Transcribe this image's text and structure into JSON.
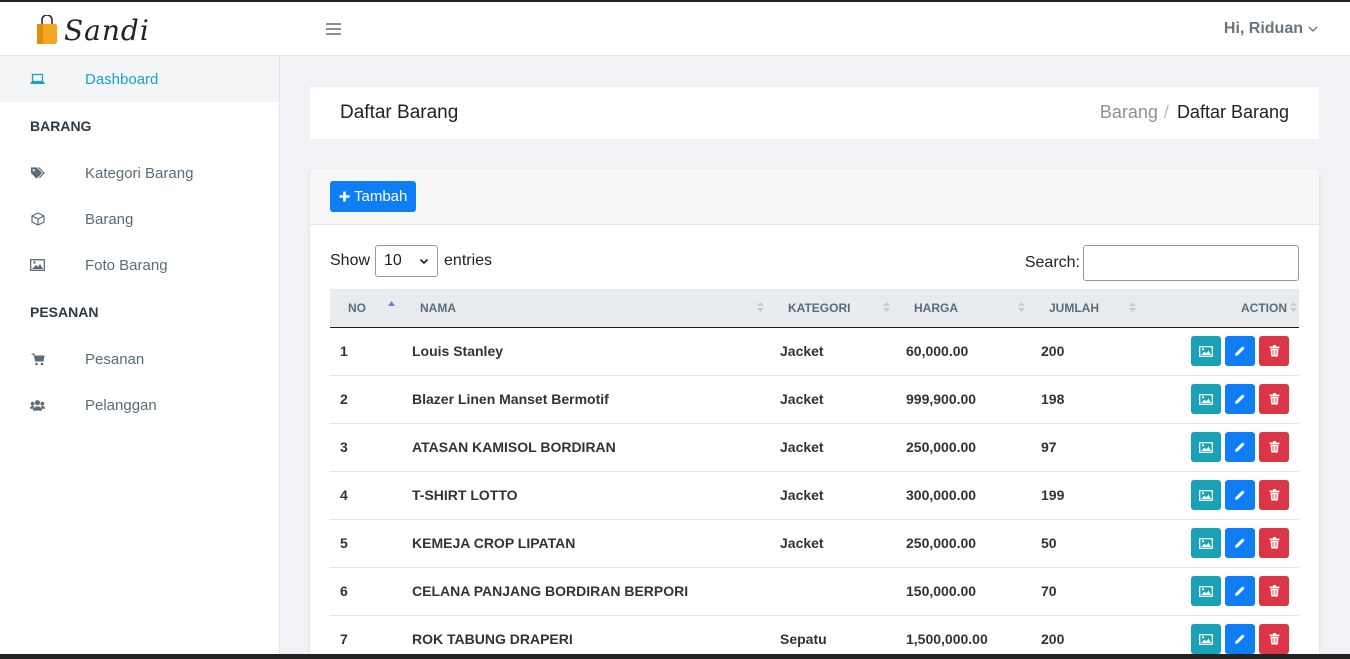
{
  "brand": {
    "name": "Sandi"
  },
  "topbar": {
    "greeting": "Hi, Riduan"
  },
  "sidebar": {
    "dashboard": "Dashboard",
    "section_barang": "BARANG",
    "kategori": "Kategori Barang",
    "barang": "Barang",
    "foto": "Foto Barang",
    "section_pesanan": "PESANAN",
    "pesanan": "Pesanan",
    "pelanggan": "Pelanggan"
  },
  "header": {
    "title": "Daftar Barang",
    "breadcrumb_parent": "Barang",
    "breadcrumb_sep": "/",
    "breadcrumb_current": "Daftar Barang"
  },
  "toolbar": {
    "add_label": "Tambah"
  },
  "table_controls": {
    "show_label": "Show",
    "page_length": "10",
    "entries_label": "entries",
    "search_label": "Search:"
  },
  "table": {
    "columns": [
      "NO",
      "NAMA",
      "KATEGORI",
      "HARGA",
      "JUMLAH",
      "ACTION"
    ],
    "rows": [
      {
        "no": "1",
        "nama": "Louis Stanley",
        "kategori": "Jacket",
        "harga": "60,000.00",
        "jumlah": "200"
      },
      {
        "no": "2",
        "nama": "Blazer Linen Manset Bermotif",
        "kategori": "Jacket",
        "harga": "999,900.00",
        "jumlah": "198"
      },
      {
        "no": "3",
        "nama": "ATASAN KAMISOL BORDIRAN",
        "kategori": "Jacket",
        "harga": "250,000.00",
        "jumlah": "97"
      },
      {
        "no": "4",
        "nama": "T-SHIRT LOTTO",
        "kategori": "Jacket",
        "harga": "300,000.00",
        "jumlah": "199"
      },
      {
        "no": "5",
        "nama": "KEMEJA CROP LIPATAN",
        "kategori": "Jacket",
        "harga": "250,000.00",
        "jumlah": "50"
      },
      {
        "no": "6",
        "nama": "CELANA PANJANG BORDIRAN BERPORI",
        "kategori": "",
        "harga": "150,000.00",
        "jumlah": "70"
      },
      {
        "no": "7",
        "nama": "ROK TABUNG DRAPERI",
        "kategori": "Sepatu",
        "harga": "1,500,000.00",
        "jumlah": "200"
      }
    ]
  },
  "colors": {
    "primary": "#0d7ef5",
    "info": "#17a2b8",
    "danger": "#dc3545",
    "active_link": "#17a2d6"
  }
}
